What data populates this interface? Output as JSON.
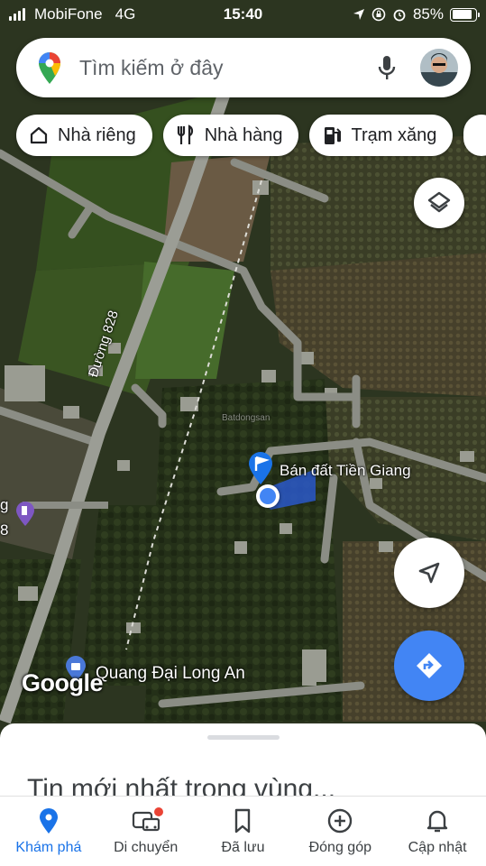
{
  "status_bar": {
    "carrier": "MobiFone",
    "network": "4G",
    "time": "15:40",
    "battery_percent": "85%",
    "battery_level": 0.85
  },
  "search": {
    "placeholder": "Tìm kiếm ở đây"
  },
  "chips": [
    {
      "label": "Nhà riêng",
      "icon": "home-icon"
    },
    {
      "label": "Nhà hàng",
      "icon": "restaurant-icon"
    },
    {
      "label": "Trạm xăng",
      "icon": "gas-station-icon"
    }
  ],
  "map": {
    "road_label": "Đường 828",
    "pin_label": "Bán đất Tiền Giang",
    "place_label": "Quang Đại Long An",
    "watermark": "Batdongsan",
    "attribution": "Google",
    "edge_label_fragment": "g",
    "edge_label_fragment_2": "8"
  },
  "sheet": {
    "title": "Tin mới nhất trong vùng..."
  },
  "bottom_nav": [
    {
      "label": "Khám phá",
      "icon": "explore-pin-icon",
      "active": true
    },
    {
      "label": "Di chuyển",
      "icon": "commute-icon",
      "active": false
    },
    {
      "label": "Đã lưu",
      "icon": "bookmark-icon",
      "active": false
    },
    {
      "label": "Đóng góp",
      "icon": "add-circle-icon",
      "active": false
    },
    {
      "label": "Cập nhật",
      "icon": "bell-icon",
      "active": false
    }
  ],
  "colors": {
    "accent": "#1a73e8",
    "fab_blue": "#4285f4",
    "pin_blue": "#1a73e8",
    "notification_red": "#ea4335"
  }
}
